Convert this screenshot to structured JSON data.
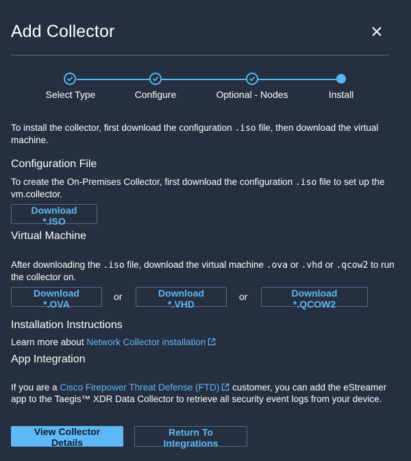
{
  "header": {
    "title": "Add Collector",
    "close_icon": "close-icon"
  },
  "stepper": {
    "steps": [
      {
        "label": "Select Type",
        "state": "done"
      },
      {
        "label": "Configure",
        "state": "done"
      },
      {
        "label": "Optional - Nodes",
        "state": "done"
      },
      {
        "label": "Install",
        "state": "current"
      }
    ]
  },
  "intro": {
    "t1": "To install the collector, first download the configuration ",
    "code": ".iso",
    "t2": " file, then download the virtual machine."
  },
  "config": {
    "heading": "Configuration File",
    "t1": "To create the On-Premises Collector, first download the configuration ",
    "code": ".iso",
    "t2": " file to set up the vm.collector.",
    "button": "Download *.ISO"
  },
  "vm": {
    "heading": "Virtual Machine",
    "t1": "After downloading the ",
    "code1": ".iso",
    "t2": " file, download the virtual machine ",
    "code2": ".ova",
    "t3": " or ",
    "code3": ".vhd",
    "t4": " or ",
    "code4": ".qcow2",
    "t5": " to run the collector on.",
    "btn_ova": "Download *.OVA",
    "btn_vhd": "Download *.VHD",
    "btn_qcow2": "Download *.QCOW2",
    "or": "or"
  },
  "install": {
    "heading": "Installation Instructions",
    "t1": "Learn more about ",
    "link": "Network Collector installation"
  },
  "app": {
    "heading": "App Integration",
    "t1": "If you are a ",
    "link": "Cisco Firepower Threat Defense (FTD)",
    "t2": " customer, you can add the eStreamer app to the Taegis™ XDR Data Collector to retrieve all security event logs from your device."
  },
  "footer": {
    "primary": "View Collector Details",
    "secondary": "Return To Integrations"
  },
  "colors": {
    "accent": "#5fb8f6",
    "background": "#262f3f"
  }
}
